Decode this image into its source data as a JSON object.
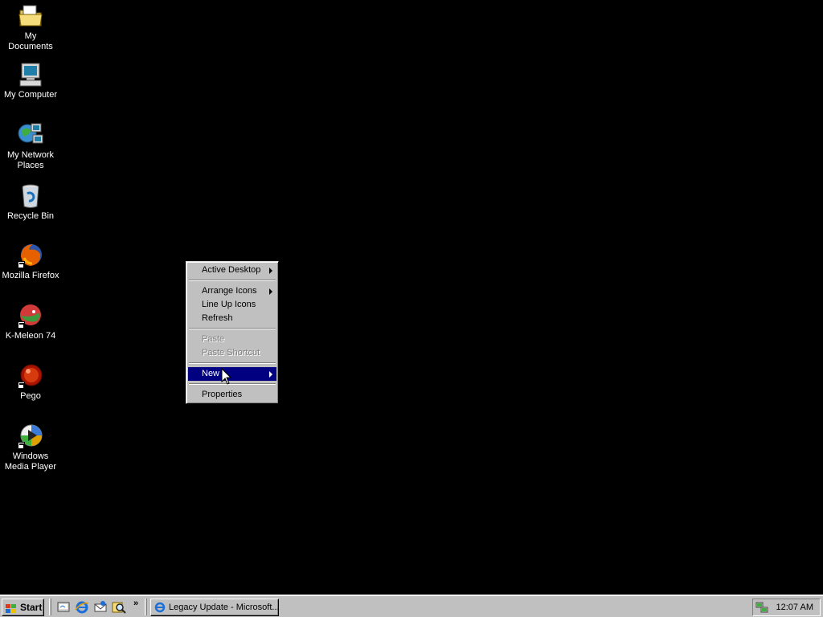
{
  "desktop": {
    "icons": [
      {
        "label": "My Documents",
        "icon": "folder-documents-icon"
      },
      {
        "label": "My Computer",
        "icon": "computer-icon"
      },
      {
        "label": "My Network Places",
        "icon": "network-places-icon"
      },
      {
        "label": "Recycle Bin",
        "icon": "recycle-bin-icon"
      },
      {
        "label": "Mozilla Firefox",
        "icon": "firefox-icon"
      },
      {
        "label": "K-Meleon 74",
        "icon": "k-meleon-icon"
      },
      {
        "label": "Pego",
        "icon": "pego-icon"
      },
      {
        "label": "Windows Media Player",
        "icon": "media-player-icon"
      }
    ]
  },
  "context_menu": {
    "items": [
      {
        "label": "Active Desktop",
        "submenu": true
      },
      {
        "label": "Arrange Icons",
        "submenu": true
      },
      {
        "label": "Line Up Icons"
      },
      {
        "label": "Refresh"
      },
      {
        "label": "Paste",
        "disabled": true
      },
      {
        "label": "Paste Shortcut",
        "disabled": true
      },
      {
        "label": "New",
        "submenu": true,
        "highlighted": true
      },
      {
        "label": "Properties"
      }
    ]
  },
  "taskbar": {
    "start_label": "Start",
    "quick_launch": [
      "desktop-icon",
      "internet-explorer-icon",
      "outlook-express-icon",
      "search-icon"
    ],
    "overflow_label": "»",
    "tasks": [
      {
        "label": "Legacy Update - Microsoft...",
        "icon": "internet-explorer-icon"
      }
    ],
    "clock": "12:07 AM"
  },
  "colors": {
    "desktop": "#000000",
    "face": "#c0c0c0",
    "highlight": "#000080"
  }
}
